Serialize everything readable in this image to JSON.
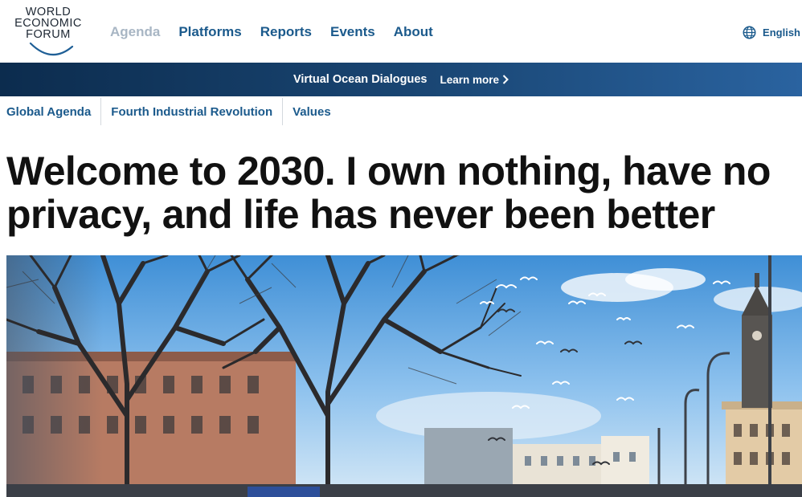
{
  "header": {
    "logo_lines": [
      "WORLD",
      "ECONOMIC",
      "FORUM"
    ],
    "nav": [
      {
        "label": "Agenda",
        "state": "muted"
      },
      {
        "label": "Platforms"
      },
      {
        "label": "Reports"
      },
      {
        "label": "Events"
      },
      {
        "label": "About"
      }
    ],
    "language": {
      "label": "English",
      "icon": "globe-icon"
    }
  },
  "banner": {
    "title": "Virtual Ocean Dialogues",
    "link_label": "Learn more",
    "link_icon": "chevron-right-icon"
  },
  "tags": [
    "Global Agenda",
    "Fourth Industrial Revolution",
    "Values"
  ],
  "article": {
    "headline": "Welcome to 2030. I own nothing, have no privacy, and life has never been better"
  },
  "colors": {
    "brand_blue": "#1b5a8c",
    "banner_dark": "#0c2c4e",
    "banner_light": "#2a63a0",
    "muted_nav": "#a8b6c4"
  }
}
